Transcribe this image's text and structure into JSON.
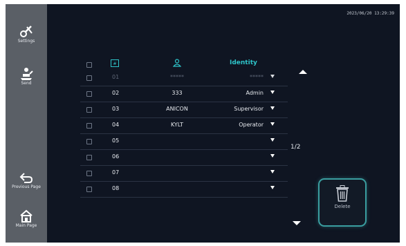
{
  "clock": "2023/06/20 13:29:39",
  "sidebar": {
    "items": [
      {
        "label": "Settings",
        "icon": "settings-tools-icon"
      },
      {
        "label": "Send",
        "icon": "person-raising-hand-icon"
      },
      {
        "label": "Previous Page",
        "icon": "back-arrow-icon"
      },
      {
        "label": "Main Page",
        "icon": "home-icon"
      }
    ]
  },
  "table": {
    "header": {
      "no_icon": "list-number-icon",
      "user_icon": "user-icon",
      "identity": "Identity"
    },
    "rows": [
      {
        "no": "01",
        "user": "*****",
        "identity": "*****",
        "dim": true
      },
      {
        "no": "02",
        "user": "333",
        "identity": "Admin",
        "dim": false
      },
      {
        "no": "03",
        "user": "ANICON",
        "identity": "Supervisor",
        "dim": false
      },
      {
        "no": "04",
        "user": "KYLT",
        "identity": "Operator",
        "dim": false
      },
      {
        "no": "05",
        "user": "",
        "identity": "",
        "dim": false
      },
      {
        "no": "06",
        "user": "",
        "identity": "",
        "dim": false
      },
      {
        "no": "07",
        "user": "",
        "identity": "",
        "dim": false
      },
      {
        "no": "08",
        "user": "",
        "identity": "",
        "dim": false
      }
    ]
  },
  "pager": {
    "indicator": "1/2"
  },
  "delete_button": {
    "label": "Delete",
    "icon": "trash-icon"
  },
  "colors": {
    "background": "#0f1522",
    "sidebar": "#5a5f66",
    "accent_cyan": "#2ec4c9",
    "delete_border": "#3a9ea0"
  }
}
